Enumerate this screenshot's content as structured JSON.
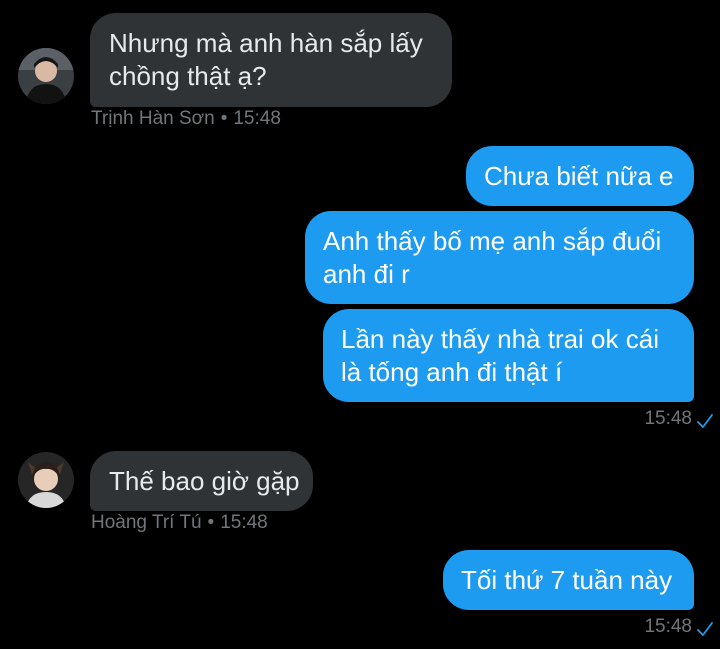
{
  "colors": {
    "background": "#000000",
    "incoming_bubble": "#2f3336",
    "outgoing_bubble": "#1d9bf0",
    "meta_text": "#71767b",
    "read_check": "#1d9bf0"
  },
  "messages": [
    {
      "direction": "incoming",
      "lines": [
        "Nhưng mà anh hàn sắp lấy",
        "chồng thật ạ?"
      ],
      "sender": "Trịnh Hàn Sơn",
      "time": "15:48",
      "avatar_icon": "user-avatar-icon"
    },
    {
      "direction": "outgoing",
      "lines": [
        "Chưa biết nữa e"
      ]
    },
    {
      "direction": "outgoing",
      "lines": [
        "Anh thấy bố mẹ anh sắp đuổi",
        "anh đi r"
      ]
    },
    {
      "direction": "outgoing",
      "lines": [
        "Lần này thấy nhà trai ok cái",
        "là tống anh đi thật í"
      ],
      "time": "15:48",
      "status_icon": "read-check-icon"
    },
    {
      "direction": "incoming",
      "lines": [
        "Thế bao giờ gặp"
      ],
      "sender": "Hoàng Trí Tú",
      "time": "15:48",
      "avatar_icon": "user-avatar-icon"
    },
    {
      "direction": "outgoing",
      "lines": [
        "Tối thứ 7 tuần này"
      ],
      "time": "15:48",
      "status_icon": "read-check-icon"
    }
  ],
  "separator": "•"
}
